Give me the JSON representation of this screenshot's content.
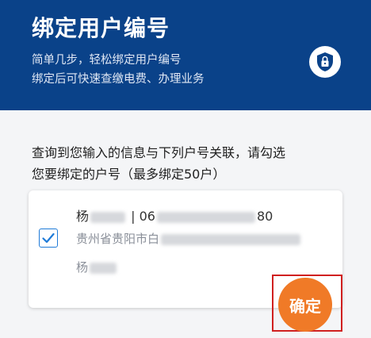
{
  "header": {
    "title": "绑定用户编号",
    "subtitle_line1": "简单几步，轻松绑定用户编号",
    "subtitle_line2": "绑定后可快速查缴电费、办理业务",
    "badge_icon": "shield-lock-icon"
  },
  "main": {
    "prompt_line1": "查询到您输入的信息与下列户号关联，请勾选",
    "prompt_line2": "您要绑定的户号（最多绑定50户）"
  },
  "account": {
    "checked": true,
    "name_prefix": "杨",
    "separator": " | ",
    "number_prefix": "06",
    "number_suffix": "80",
    "address_prefix": "贵州省贵阳市白",
    "line3_prefix": "杨"
  },
  "confirm": {
    "label": "确定"
  },
  "colors": {
    "header_bg": "#0a4289",
    "accent": "#1f7bd8",
    "confirm_bg": "#f07a27",
    "highlight": "#d02020"
  }
}
